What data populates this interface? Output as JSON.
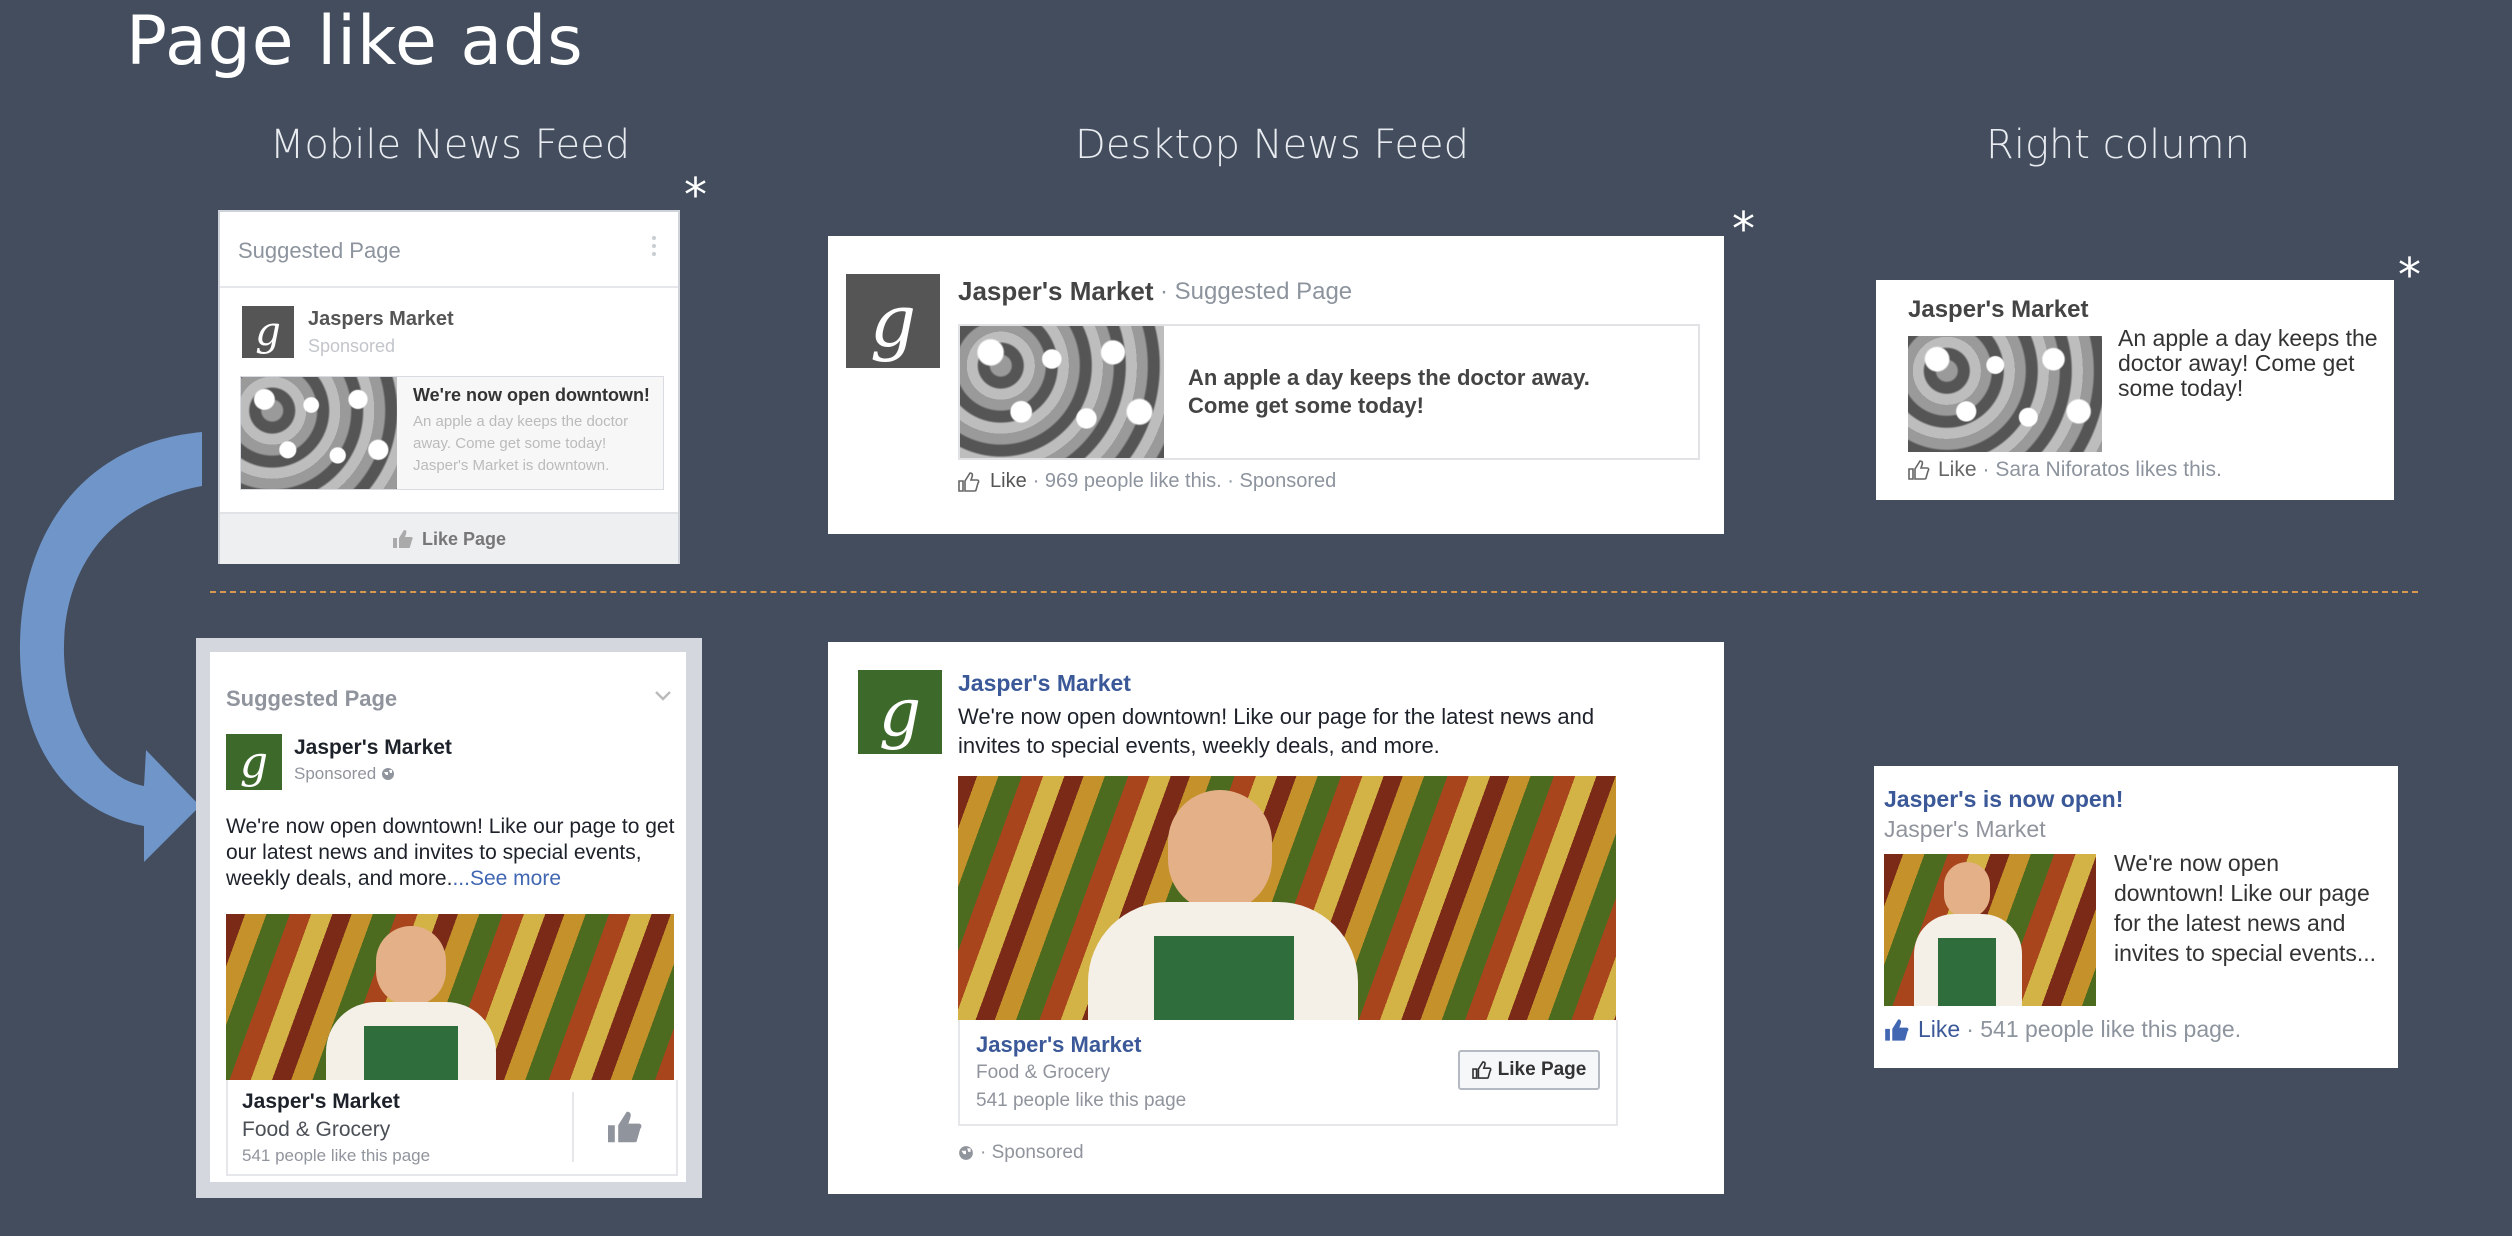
{
  "page": {
    "title": "Page like ads"
  },
  "columns": {
    "mobile": "Mobile News Feed",
    "desktop": "Desktop News Feed",
    "right": "Right column"
  },
  "asterisk": "*",
  "old_mobile": {
    "header": "Suggested Page",
    "name": "Jaspers Market",
    "sponsored": "Sponsored",
    "headline": "We're now open downtown!",
    "body": "An apple a day keeps the doctor away. Come get some today! Jasper's Market is downtown.",
    "like_label": "Like Page"
  },
  "old_desktop": {
    "name": "Jasper's Market",
    "suffix": "· Suggested Page",
    "text": "An apple a day keeps the doctor away. Come get some today!",
    "footer_like": "Like",
    "footer_rest": "· 969 people like this. · Sponsored"
  },
  "old_right": {
    "name": "Jasper's Market",
    "text": "An apple a day keeps the doctor away! Come get some today!",
    "footer_like": "Like",
    "footer_rest": "· Sara Niforatos likes this."
  },
  "new_mobile": {
    "header": "Suggested Page",
    "name": "Jasper's Market",
    "sponsored": "Sponsored",
    "text": "We're now open downtown! Like our page to get our latest news and invites to special events, weekly deals, and more.",
    "see_more": "...See more",
    "card_name": "Jasper's Market",
    "category": "Food & Grocery",
    "likes": "541 people like this page"
  },
  "new_desktop": {
    "name": "Jasper's Market",
    "text": "We're now open downtown! Like our page for the latest news and invites to special events, weekly deals, and more.",
    "card_name": "Jasper's Market",
    "category": "Food & Grocery",
    "likes": "541 people like this page",
    "like_button": "Like Page",
    "sponsored": "· Sponsored"
  },
  "new_right": {
    "title": "Jasper's is now open!",
    "name": "Jasper's Market",
    "text": "We're now open downtown! Like our page for the latest news and invites to special events...",
    "footer_like": "Like",
    "footer_rest": "· 541 people like this page."
  },
  "colors": {
    "background": "#434d5d",
    "divider": "#d9964d",
    "fb_blue": "#3b5998",
    "arrow": "#6f95c9",
    "logo_green": "#3d6a2b"
  },
  "icons": [
    "thumbs-up-icon",
    "globe-icon",
    "chevron-down-icon",
    "more-icon",
    "curved-arrow-icon"
  ]
}
